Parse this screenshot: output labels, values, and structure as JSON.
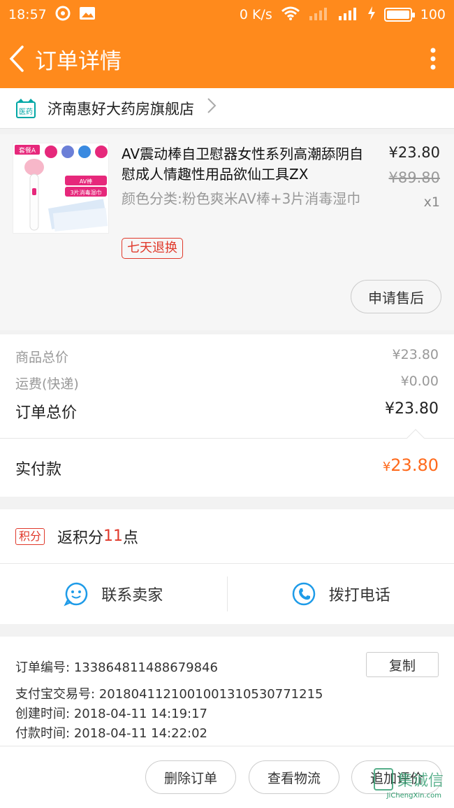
{
  "status_bar": {
    "time": "18:57",
    "net_speed": "0 K/s",
    "battery_level": "100",
    "battery_fraction": 1.0
  },
  "header": {
    "title": "订单详情"
  },
  "shop": {
    "logo_text": "医药",
    "name": "济南惠好大药房旗舰店"
  },
  "item": {
    "thumb": {
      "combo": "套餐A",
      "tag1": "AV棒",
      "tag2": "3片消毒湿巾"
    },
    "title": "AV震动棒自卫慰器女性系列高潮舔阴自慰成人情趣性用品欲仙工具ZX",
    "sku": "颜色分类:粉色爽米AV棒+3片消毒湿巾",
    "badge": "七天退换",
    "price": "¥23.80",
    "original_price": "¥89.80",
    "quantity": "x1",
    "after_sale_button": "申请售后"
  },
  "summary": {
    "goods_total_label": "商品总价",
    "goods_total": "¥23.80",
    "shipping_label": "运费(快递)",
    "shipping": "¥0.00",
    "order_total_label": "订单总价",
    "order_total": "¥23.80"
  },
  "paid": {
    "label": "实付款",
    "currency": "¥",
    "amount": "23.80"
  },
  "points": {
    "tag": "积分",
    "text_prefix": "返积分",
    "number": "11",
    "text_suffix": "点"
  },
  "contact": {
    "seller": "联系卖家",
    "call": "拨打电话"
  },
  "order_info": {
    "number_label": "订单编号:",
    "number": "1338648114886798​46",
    "copy_button": "复制",
    "alipay_label": "支付宝交易号:",
    "alipay": "2018041121001001310530771215",
    "created_label": "创建时间:",
    "created": "2018-04-11 14:19:17",
    "paid_label": "付款时间:",
    "paid": "2018-04-11 14:22:02"
  },
  "actions": {
    "delete": "删除订单",
    "logistics": "查看物流",
    "review": "追加评价"
  },
  "watermark": {
    "text": "JiChengXin.com",
    "cn": "集诚信"
  },
  "colors": {
    "brand": "#ff8a1c",
    "accent_red": "#e0392b",
    "paid_orange": "#ff6a1c"
  }
}
